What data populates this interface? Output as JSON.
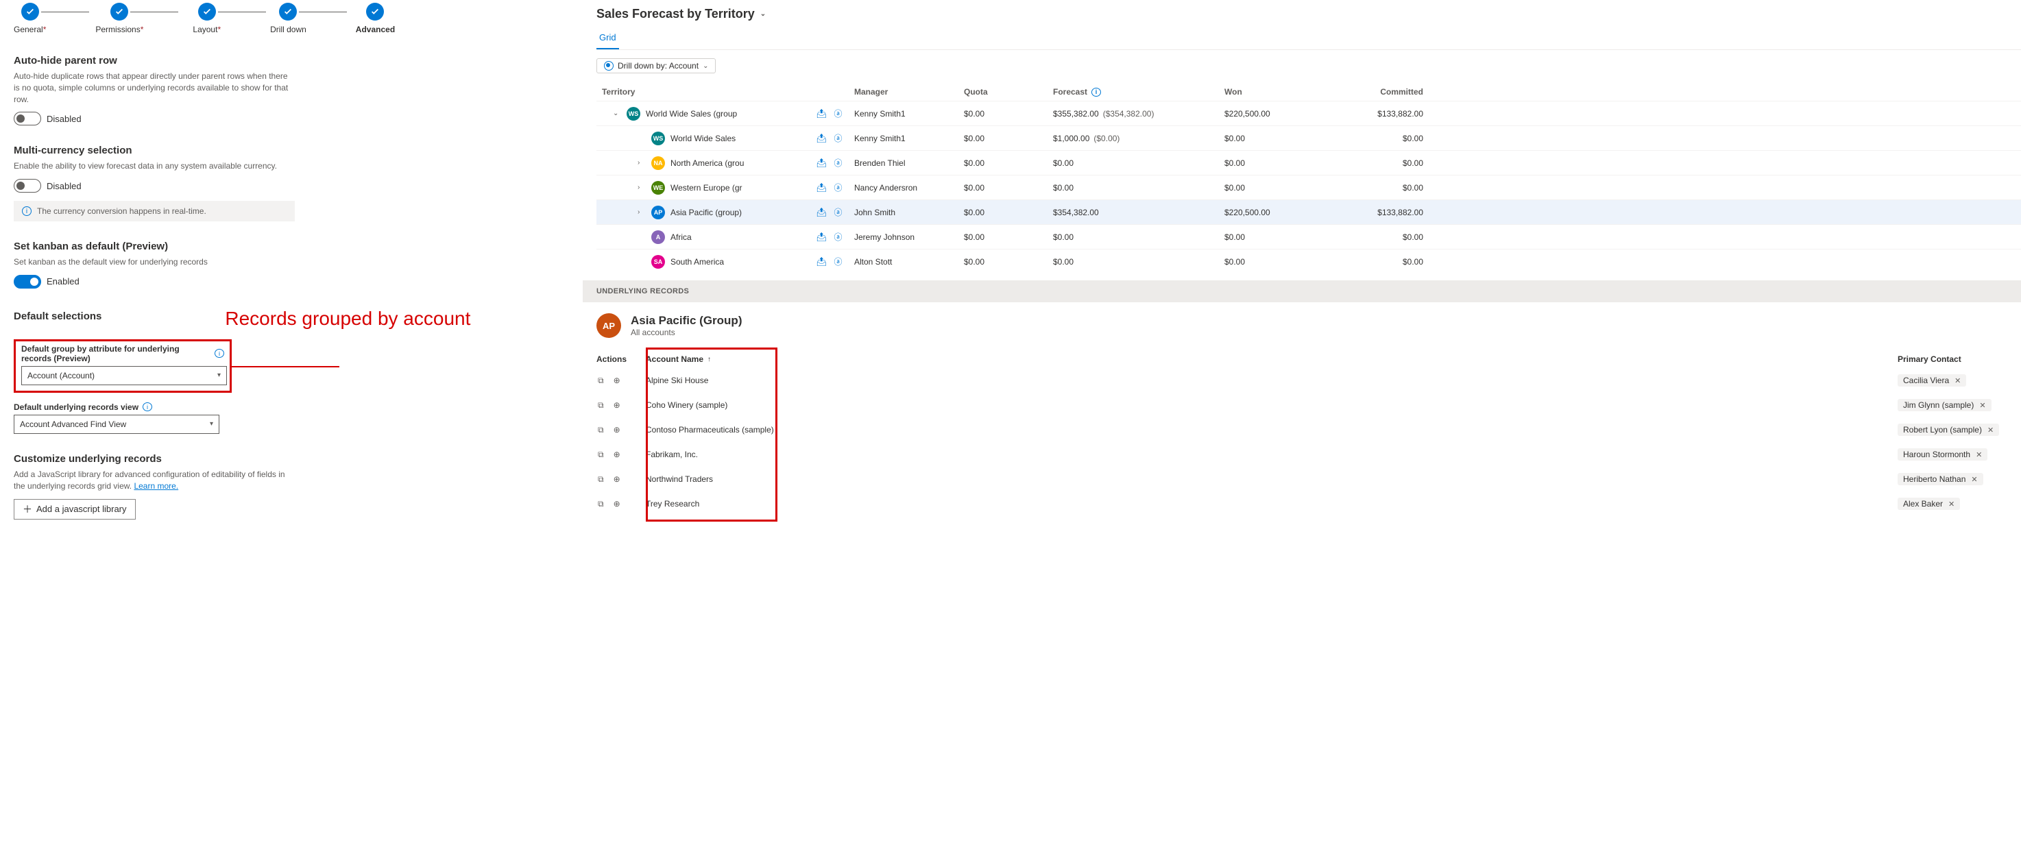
{
  "stepper": {
    "items": [
      {
        "label": "General",
        "required": true
      },
      {
        "label": "Permissions",
        "required": true
      },
      {
        "label": "Layout",
        "required": true
      },
      {
        "label": "Drill down",
        "required": false
      },
      {
        "label": "Advanced",
        "required": false
      }
    ],
    "active_index": 4
  },
  "sections": {
    "auto_hide": {
      "title": "Auto-hide parent row",
      "desc": "Auto-hide duplicate rows that appear directly under parent rows when there is no quota, simple columns or underlying records available to show for that row.",
      "toggle_label": "Disabled",
      "toggle_on": false
    },
    "multi_currency": {
      "title": "Multi-currency selection",
      "desc": "Enable the ability to view forecast data in any system available currency.",
      "toggle_label": "Disabled",
      "toggle_on": false,
      "banner": "The currency conversion happens in real-time."
    },
    "kanban": {
      "title": "Set kanban as default (Preview)",
      "desc": "Set kanban as the default view for underlying records",
      "toggle_label": "Enabled",
      "toggle_on": true
    },
    "default_selections": {
      "title": "Default selections",
      "group_by_label": "Default group by attribute for underlying records (Preview)",
      "group_by_value": "Account (Account)",
      "view_label": "Default underlying records view",
      "view_value": "Account Advanced Find View"
    },
    "customize": {
      "title": "Customize underlying records",
      "desc": "Add a JavaScript library for advanced configuration of editability of fields in the underlying records grid view. ",
      "learn_more": "Learn more.",
      "btn_label": "Add a javascript library"
    }
  },
  "annotation": "Records grouped by account",
  "forecast": {
    "title": "Sales Forecast by Territory",
    "tab": "Grid",
    "drill_label": "Drill down by: Account",
    "columns": [
      "Territory",
      "Manager",
      "Quota",
      "Forecast",
      "Won",
      "Committed"
    ],
    "rows": [
      {
        "indent": 0,
        "caret": "down",
        "avatar": "WS",
        "color": "#038387",
        "name": "World Wide Sales (group",
        "mgr": "Kenny Smith1",
        "quota": "$0.00",
        "fc": "$355,382.00",
        "fc_sub": "($354,382.00)",
        "won": "$220,500.00",
        "com": "$133,882.00",
        "sel": false
      },
      {
        "indent": 1,
        "caret": "",
        "avatar": "WS",
        "color": "#038387",
        "name": "World Wide Sales",
        "mgr": "Kenny Smith1",
        "quota": "$0.00",
        "fc": "$1,000.00",
        "fc_sub": "($0.00)",
        "won": "$0.00",
        "com": "$0.00",
        "sel": false
      },
      {
        "indent": 1,
        "caret": "right",
        "avatar": "NA",
        "color": "#ffb900",
        "name": "North America (grou",
        "mgr": "Brenden Thiel",
        "quota": "$0.00",
        "fc": "$0.00",
        "fc_sub": "",
        "won": "$0.00",
        "com": "$0.00",
        "sel": false
      },
      {
        "indent": 1,
        "caret": "right",
        "avatar": "WE",
        "color": "#498205",
        "name": "Western Europe (gr",
        "mgr": "Nancy Andersron",
        "quota": "$0.00",
        "fc": "$0.00",
        "fc_sub": "",
        "won": "$0.00",
        "com": "$0.00",
        "sel": false
      },
      {
        "indent": 1,
        "caret": "right",
        "avatar": "AP",
        "color": "#0078d4",
        "name": "Asia Pacific (group)",
        "mgr": "John Smith",
        "quota": "$0.00",
        "fc": "$354,382.00",
        "fc_sub": "",
        "won": "$220,500.00",
        "com": "$133,882.00",
        "sel": true
      },
      {
        "indent": 1,
        "caret": "",
        "avatar": "A",
        "color": "#8764b8",
        "name": "Africa",
        "mgr": "Jeremy Johnson",
        "quota": "$0.00",
        "fc": "$0.00",
        "fc_sub": "",
        "won": "$0.00",
        "com": "$0.00",
        "sel": false
      },
      {
        "indent": 1,
        "caret": "",
        "avatar": "SA",
        "color": "#e3008c",
        "name": "South America",
        "mgr": "Alton Stott",
        "quota": "$0.00",
        "fc": "$0.00",
        "fc_sub": "",
        "won": "$0.00",
        "com": "$0.00",
        "sel": false
      }
    ]
  },
  "underlying": {
    "heading": "UNDERLYING RECORDS",
    "avatar": "AP",
    "title": "Asia Pacific (Group)",
    "subtitle": "All accounts",
    "col_actions": "Actions",
    "col_name": "Account Name",
    "col_pc": "Primary Contact",
    "rows": [
      {
        "name": "Alpine Ski House",
        "pc": "Cacilia Viera"
      },
      {
        "name": "Coho Winery (sample)",
        "pc": "Jim Glynn (sample)"
      },
      {
        "name": "Contoso Pharmaceuticals (sample)",
        "pc": "Robert Lyon (sample)"
      },
      {
        "name": "Fabrikam, Inc.",
        "pc": "Haroun Stormonth"
      },
      {
        "name": "Northwind Traders",
        "pc": "Heriberto Nathan"
      },
      {
        "name": "Trey Research",
        "pc": "Alex Baker"
      }
    ]
  }
}
